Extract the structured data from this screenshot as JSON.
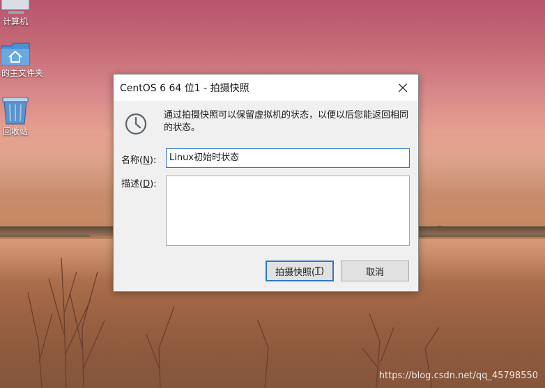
{
  "desktop": {
    "icons": [
      {
        "label": "计算机"
      },
      {
        "label": "的主文件夹"
      },
      {
        "label": "回收站"
      }
    ],
    "watermark": "https://blog.csdn.net/qq_45798550"
  },
  "dialog": {
    "title": "CentOS 6 64 位1 - 拍摄快照",
    "info_text": "通过拍摄快照可以保留虚拟机的状态，以便以后您能返回相同的状态。",
    "name": {
      "label": "名称(",
      "accel": "N",
      "suffix": "):",
      "value": "Linux初始时状态"
    },
    "description": {
      "label": "描述(",
      "accel": "D",
      "suffix": "):",
      "value": ""
    },
    "buttons": {
      "snapshot": {
        "label": "拍摄快照(",
        "accel": "T",
        "suffix": ")"
      },
      "cancel": {
        "label": "取消"
      }
    }
  }
}
